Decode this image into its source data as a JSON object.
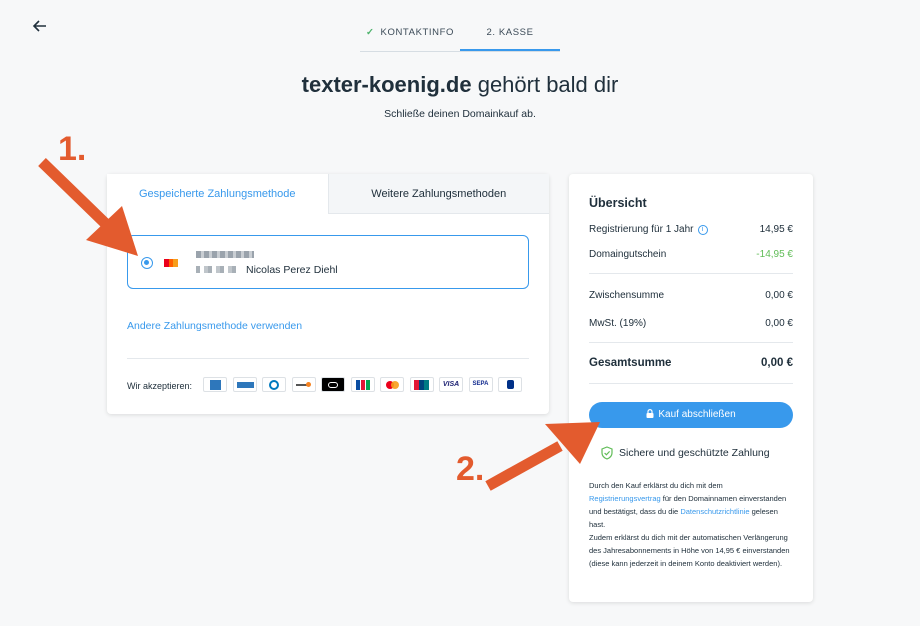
{
  "nav": {
    "back_icon": "arrow-left-icon"
  },
  "steps": [
    {
      "label": "KONTAKTINFO",
      "done": true
    },
    {
      "label": "2.  KASSE",
      "done": false
    }
  ],
  "header": {
    "domain": "texter-koenig.de",
    "title_rest": "gehört bald dir",
    "subtitle": "Schließe deinen Domainkauf ab."
  },
  "payment": {
    "tabs": [
      "Gespeicherte Zahlungsmethode",
      "Weitere Zahlungsmethoden"
    ],
    "saved_method": {
      "holder": "Nicolas Perez Diehl",
      "brand_icon": "mastercard-icon"
    },
    "alt_link": "Andere Zahlungsmethode verwenden",
    "accept_label": "Wir akzeptieren:",
    "card_icons": [
      "amex-icon",
      "amex-alt-icon",
      "diners-icon",
      "discover-icon",
      "elo-icon",
      "jcb-icon",
      "mastercard-icon",
      "unionpay-icon",
      "visa-icon",
      "sepa-icon",
      "paypal-icon"
    ]
  },
  "summary": {
    "title": "Übersicht",
    "registration_label": "Registrierung für 1 Jahr",
    "registration_value": "14,95 €",
    "voucher_label": "Domaingutschein",
    "voucher_value": "-14,95 €",
    "subtotal_label": "Zwischensumme",
    "subtotal_value": "0,00 €",
    "vat_label": "MwSt. (19%)",
    "vat_value": "0,00 €",
    "total_label": "Gesamtsumme",
    "total_value": "0,00 €",
    "buy_button": "Kauf abschließen",
    "secure_text": "Sichere und geschützte Zahlung",
    "legal_1": "Durch den Kauf erklärst du dich mit dem",
    "legal_link1": "Registrierungsvertrag",
    "legal_2": " für den Domainnamen einverstanden und bestätigst, dass du die",
    "legal_link2": "Datenschutzrichtlinie",
    "legal_3": " gelesen hast.",
    "legal_4": "Zudem erklärst du dich mit der automatischen Verlängerung des Jahresabonnements in Höhe von 14,95 € einverstanden (diese kann jederzeit in deinem Konto deaktiviert werden)."
  },
  "annotations": {
    "label_1": "1.",
    "label_2": "2."
  },
  "colors": {
    "accent": "#3899ec",
    "arrow": "#e35b2e",
    "green": "#60bc57"
  }
}
